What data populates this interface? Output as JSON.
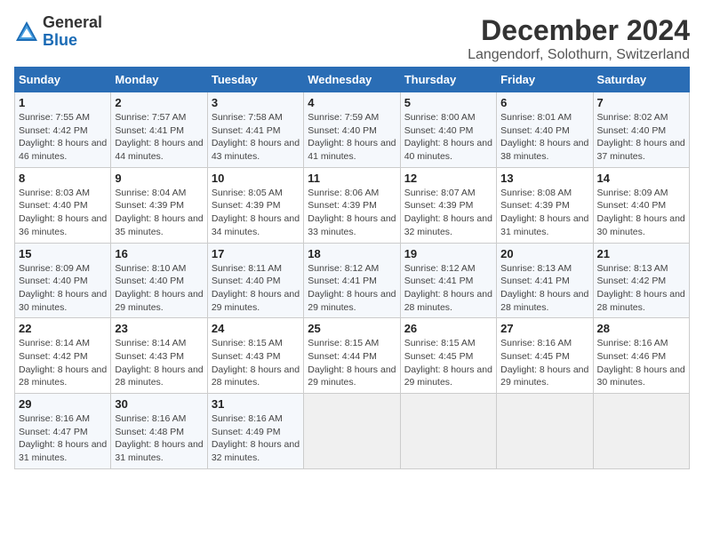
{
  "header": {
    "logo_general": "General",
    "logo_blue": "Blue",
    "title": "December 2024",
    "subtitle": "Langendorf, Solothurn, Switzerland"
  },
  "days_of_week": [
    "Sunday",
    "Monday",
    "Tuesday",
    "Wednesday",
    "Thursday",
    "Friday",
    "Saturday"
  ],
  "weeks": [
    [
      {
        "day": "1",
        "sunrise": "Sunrise: 7:55 AM",
        "sunset": "Sunset: 4:42 PM",
        "daylight": "Daylight: 8 hours and 46 minutes."
      },
      {
        "day": "2",
        "sunrise": "Sunrise: 7:57 AM",
        "sunset": "Sunset: 4:41 PM",
        "daylight": "Daylight: 8 hours and 44 minutes."
      },
      {
        "day": "3",
        "sunrise": "Sunrise: 7:58 AM",
        "sunset": "Sunset: 4:41 PM",
        "daylight": "Daylight: 8 hours and 43 minutes."
      },
      {
        "day": "4",
        "sunrise": "Sunrise: 7:59 AM",
        "sunset": "Sunset: 4:40 PM",
        "daylight": "Daylight: 8 hours and 41 minutes."
      },
      {
        "day": "5",
        "sunrise": "Sunrise: 8:00 AM",
        "sunset": "Sunset: 4:40 PM",
        "daylight": "Daylight: 8 hours and 40 minutes."
      },
      {
        "day": "6",
        "sunrise": "Sunrise: 8:01 AM",
        "sunset": "Sunset: 4:40 PM",
        "daylight": "Daylight: 8 hours and 38 minutes."
      },
      {
        "day": "7",
        "sunrise": "Sunrise: 8:02 AM",
        "sunset": "Sunset: 4:40 PM",
        "daylight": "Daylight: 8 hours and 37 minutes."
      }
    ],
    [
      {
        "day": "8",
        "sunrise": "Sunrise: 8:03 AM",
        "sunset": "Sunset: 4:40 PM",
        "daylight": "Daylight: 8 hours and 36 minutes."
      },
      {
        "day": "9",
        "sunrise": "Sunrise: 8:04 AM",
        "sunset": "Sunset: 4:39 PM",
        "daylight": "Daylight: 8 hours and 35 minutes."
      },
      {
        "day": "10",
        "sunrise": "Sunrise: 8:05 AM",
        "sunset": "Sunset: 4:39 PM",
        "daylight": "Daylight: 8 hours and 34 minutes."
      },
      {
        "day": "11",
        "sunrise": "Sunrise: 8:06 AM",
        "sunset": "Sunset: 4:39 PM",
        "daylight": "Daylight: 8 hours and 33 minutes."
      },
      {
        "day": "12",
        "sunrise": "Sunrise: 8:07 AM",
        "sunset": "Sunset: 4:39 PM",
        "daylight": "Daylight: 8 hours and 32 minutes."
      },
      {
        "day": "13",
        "sunrise": "Sunrise: 8:08 AM",
        "sunset": "Sunset: 4:39 PM",
        "daylight": "Daylight: 8 hours and 31 minutes."
      },
      {
        "day": "14",
        "sunrise": "Sunrise: 8:09 AM",
        "sunset": "Sunset: 4:40 PM",
        "daylight": "Daylight: 8 hours and 30 minutes."
      }
    ],
    [
      {
        "day": "15",
        "sunrise": "Sunrise: 8:09 AM",
        "sunset": "Sunset: 4:40 PM",
        "daylight": "Daylight: 8 hours and 30 minutes."
      },
      {
        "day": "16",
        "sunrise": "Sunrise: 8:10 AM",
        "sunset": "Sunset: 4:40 PM",
        "daylight": "Daylight: 8 hours and 29 minutes."
      },
      {
        "day": "17",
        "sunrise": "Sunrise: 8:11 AM",
        "sunset": "Sunset: 4:40 PM",
        "daylight": "Daylight: 8 hours and 29 minutes."
      },
      {
        "day": "18",
        "sunrise": "Sunrise: 8:12 AM",
        "sunset": "Sunset: 4:41 PM",
        "daylight": "Daylight: 8 hours and 29 minutes."
      },
      {
        "day": "19",
        "sunrise": "Sunrise: 8:12 AM",
        "sunset": "Sunset: 4:41 PM",
        "daylight": "Daylight: 8 hours and 28 minutes."
      },
      {
        "day": "20",
        "sunrise": "Sunrise: 8:13 AM",
        "sunset": "Sunset: 4:41 PM",
        "daylight": "Daylight: 8 hours and 28 minutes."
      },
      {
        "day": "21",
        "sunrise": "Sunrise: 8:13 AM",
        "sunset": "Sunset: 4:42 PM",
        "daylight": "Daylight: 8 hours and 28 minutes."
      }
    ],
    [
      {
        "day": "22",
        "sunrise": "Sunrise: 8:14 AM",
        "sunset": "Sunset: 4:42 PM",
        "daylight": "Daylight: 8 hours and 28 minutes."
      },
      {
        "day": "23",
        "sunrise": "Sunrise: 8:14 AM",
        "sunset": "Sunset: 4:43 PM",
        "daylight": "Daylight: 8 hours and 28 minutes."
      },
      {
        "day": "24",
        "sunrise": "Sunrise: 8:15 AM",
        "sunset": "Sunset: 4:43 PM",
        "daylight": "Daylight: 8 hours and 28 minutes."
      },
      {
        "day": "25",
        "sunrise": "Sunrise: 8:15 AM",
        "sunset": "Sunset: 4:44 PM",
        "daylight": "Daylight: 8 hours and 29 minutes."
      },
      {
        "day": "26",
        "sunrise": "Sunrise: 8:15 AM",
        "sunset": "Sunset: 4:45 PM",
        "daylight": "Daylight: 8 hours and 29 minutes."
      },
      {
        "day": "27",
        "sunrise": "Sunrise: 8:16 AM",
        "sunset": "Sunset: 4:45 PM",
        "daylight": "Daylight: 8 hours and 29 minutes."
      },
      {
        "day": "28",
        "sunrise": "Sunrise: 8:16 AM",
        "sunset": "Sunset: 4:46 PM",
        "daylight": "Daylight: 8 hours and 30 minutes."
      }
    ],
    [
      {
        "day": "29",
        "sunrise": "Sunrise: 8:16 AM",
        "sunset": "Sunset: 4:47 PM",
        "daylight": "Daylight: 8 hours and 31 minutes."
      },
      {
        "day": "30",
        "sunrise": "Sunrise: 8:16 AM",
        "sunset": "Sunset: 4:48 PM",
        "daylight": "Daylight: 8 hours and 31 minutes."
      },
      {
        "day": "31",
        "sunrise": "Sunrise: 8:16 AM",
        "sunset": "Sunset: 4:49 PM",
        "daylight": "Daylight: 8 hours and 32 minutes."
      },
      null,
      null,
      null,
      null
    ]
  ]
}
